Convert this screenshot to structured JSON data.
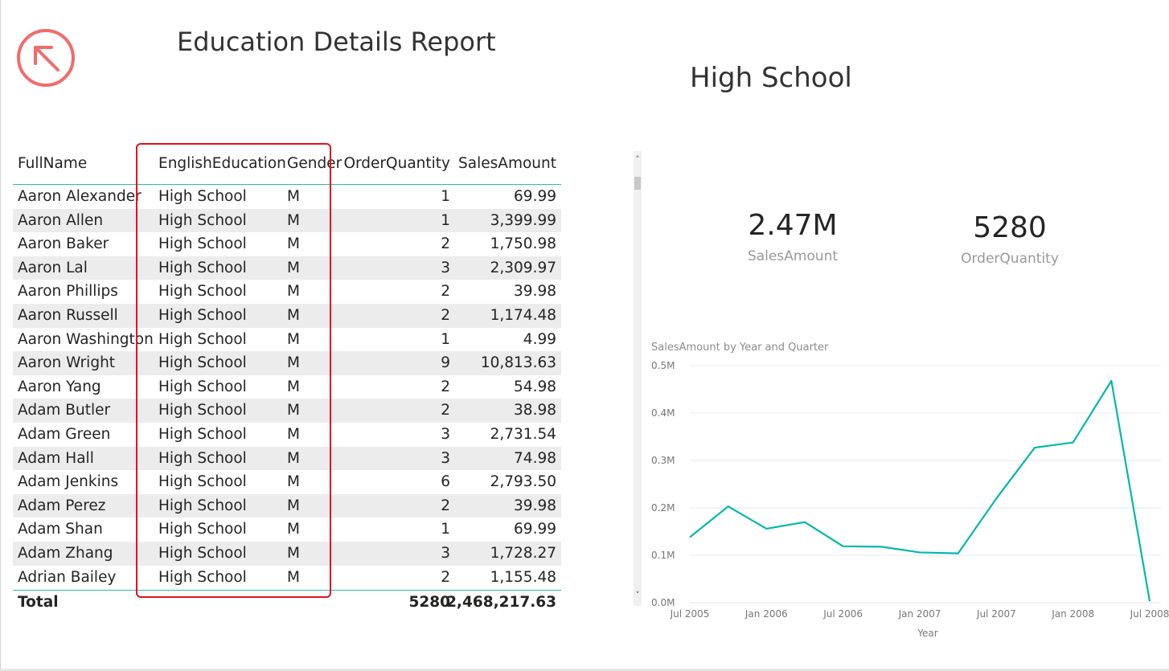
{
  "report": {
    "title": "Education Details Report",
    "filter_title": "High School",
    "back_icon": "arrow-up-left-circle-icon",
    "accent_color": "#f26b6b"
  },
  "table": {
    "columns": [
      "FullName",
      "EnglishEducation",
      "Gender",
      "OrderQuantity",
      "SalesAmount"
    ],
    "rows": [
      [
        "Aaron Alexander",
        "High School",
        "M",
        "1",
        "69.99"
      ],
      [
        "Aaron Allen",
        "High School",
        "M",
        "1",
        "3,399.99"
      ],
      [
        "Aaron Baker",
        "High School",
        "M",
        "2",
        "1,750.98"
      ],
      [
        "Aaron Lal",
        "High School",
        "M",
        "3",
        "2,309.97"
      ],
      [
        "Aaron Phillips",
        "High School",
        "M",
        "2",
        "39.98"
      ],
      [
        "Aaron Russell",
        "High School",
        "M",
        "2",
        "1,174.48"
      ],
      [
        "Aaron Washington",
        "High School",
        "M",
        "1",
        "4.99"
      ],
      [
        "Aaron Wright",
        "High School",
        "M",
        "9",
        "10,813.63"
      ],
      [
        "Aaron Yang",
        "High School",
        "M",
        "2",
        "54.98"
      ],
      [
        "Adam Butler",
        "High School",
        "M",
        "2",
        "38.98"
      ],
      [
        "Adam Green",
        "High School",
        "M",
        "3",
        "2,731.54"
      ],
      [
        "Adam Hall",
        "High School",
        "M",
        "3",
        "74.98"
      ],
      [
        "Adam Jenkins",
        "High School",
        "M",
        "6",
        "2,793.50"
      ],
      [
        "Adam Perez",
        "High School",
        "M",
        "2",
        "39.98"
      ],
      [
        "Adam Shan",
        "High School",
        "M",
        "1",
        "69.99"
      ],
      [
        "Adam Zhang",
        "High School",
        "M",
        "3",
        "1,728.27"
      ],
      [
        "Adrian Bailey",
        "High School",
        "M",
        "2",
        "1,155.48"
      ]
    ],
    "total": {
      "label": "Total",
      "order_quantity": "5280",
      "sales_amount": "2,468,217.63"
    },
    "header_line_color": "#2fb8b0",
    "highlight_color": "#e0121c"
  },
  "scrollbar": {
    "up_glyph": "˄",
    "down_glyph": "˅"
  },
  "cards": {
    "sales": {
      "value": "2.47M",
      "label": "SalesAmount"
    },
    "quantity": {
      "value": "5280",
      "label": "OrderQuantity"
    }
  },
  "chart_data": {
    "type": "line",
    "title": "SalesAmount by Year and Quarter",
    "xlabel": "Year",
    "ylabel": "",
    "x_ticks": [
      "Jul 2005",
      "Jan 2006",
      "Jul 2006",
      "Jan 2007",
      "Jul 2007",
      "Jan 2008",
      "Jul 2008"
    ],
    "y_ticks": [
      "0.0M",
      "0.1M",
      "0.2M",
      "0.3M",
      "0.4M",
      "0.5M"
    ],
    "ylim": [
      0,
      0.5
    ],
    "y_unit": "M",
    "x": [
      "2005-07-01",
      "2005-10-01",
      "2006-01-01",
      "2006-04-01",
      "2006-07-01",
      "2006-10-01",
      "2007-01-01",
      "2007-04-01",
      "2007-07-01",
      "2007-10-01",
      "2008-01-01",
      "2008-04-01",
      "2008-07-01"
    ],
    "series": [
      {
        "values": [
          0.138,
          0.203,
          0.156,
          0.17,
          0.119,
          0.118,
          0.106,
          0.104,
          0.22,
          0.327,
          0.338,
          0.468,
          0.003
        ],
        "color": "#01b8aa"
      }
    ],
    "grid": true
  }
}
